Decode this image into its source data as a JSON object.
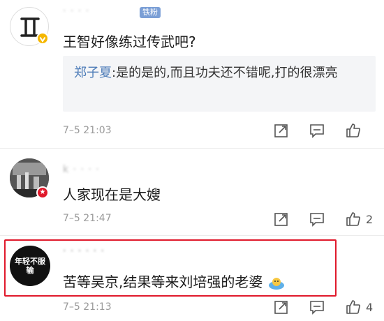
{
  "comments": [
    {
      "username": "· · · ·",
      "badge": "铁粉",
      "text": "王智好像练过传武吧?",
      "reply": {
        "name": "郑子夏",
        "text": ":是的是的,而且功夫还不错呢,打的很漂亮"
      },
      "time": "7–5 21:03",
      "likes": ""
    },
    {
      "username": "k · · · ·",
      "text": "人家现在是大嫂",
      "time": "7–5 21:47",
      "likes": "2"
    },
    {
      "username": "· · · · · ·",
      "avatar_text": "年轻不服输",
      "text": "苦等吴京,结果等来刘培强的老婆",
      "time": "7–5 21:13",
      "likes": "4"
    }
  ],
  "icons": {
    "share": "share-icon",
    "comment": "comment-icon",
    "like": "thumbs-up-icon",
    "emoji": "emoji-icon",
    "vip": "vip-badge-icon"
  },
  "colors": {
    "link": "#4d7cb8",
    "highlight": "#e0192b",
    "vip": "#f5b700"
  }
}
